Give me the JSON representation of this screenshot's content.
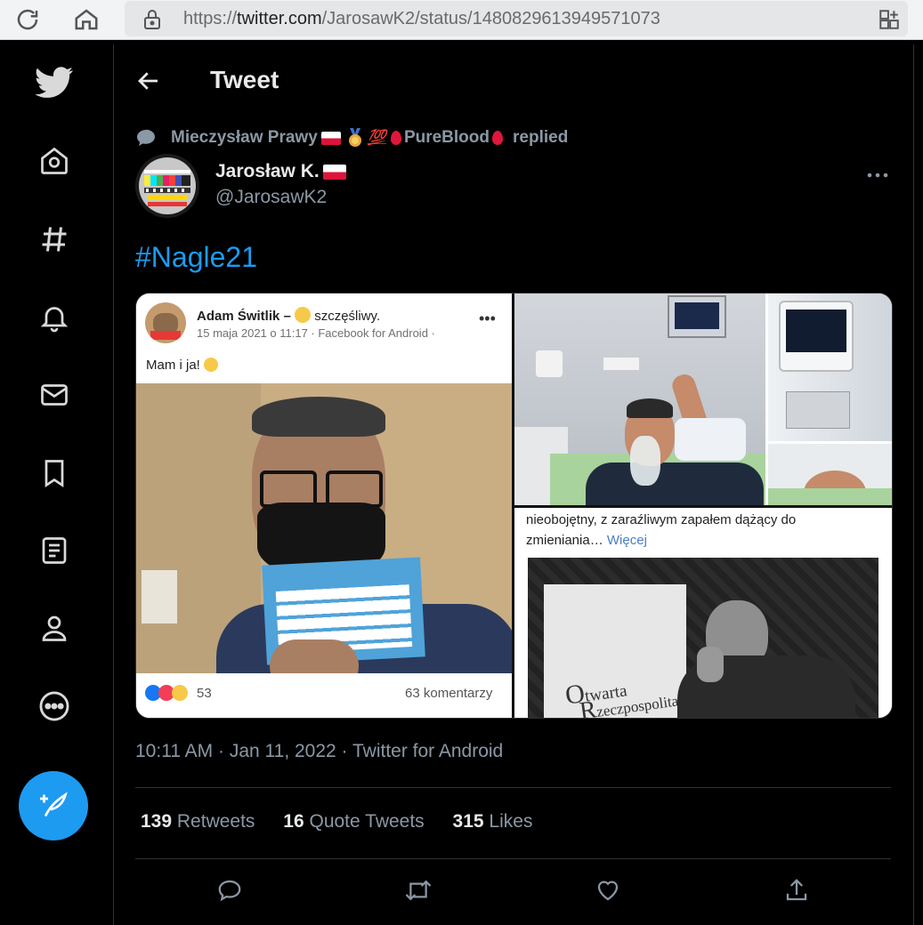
{
  "browser": {
    "url_prefix": "https://",
    "url_host": "twitter.com",
    "url_path": "/JarosawK2/status/1480829613949571073",
    "icons": [
      "reload-icon",
      "home-icon",
      "lock-icon",
      "collections-icon"
    ]
  },
  "sidebar": {
    "items": [
      {
        "icon": "twitter-logo-icon"
      },
      {
        "icon": "home-icon"
      },
      {
        "icon": "explore-hashtag-icon"
      },
      {
        "icon": "notifications-bell-icon"
      },
      {
        "icon": "messages-envelope-icon"
      },
      {
        "icon": "bookmark-icon"
      },
      {
        "icon": "lists-icon"
      },
      {
        "icon": "profile-icon"
      },
      {
        "icon": "more-circle-icon"
      }
    ],
    "compose_icon": "compose-feather-icon",
    "accent": "#1d9bf0"
  },
  "header": {
    "title": "Tweet"
  },
  "tweet": {
    "context": {
      "name": "Mieczysław Prawy",
      "badge_text": "PureBlood",
      "action": "replied"
    },
    "author": {
      "display_name": "Jarosław K.",
      "handle": "@JarosawK2"
    },
    "text": "#Nagle21",
    "media": {
      "post": {
        "author": "Adam Świtlik",
        "feeling": "szczęśliwy.",
        "meta": "15 maja 2021 o 11:17 · Facebook for Android ·",
        "text": "Mam i ja!",
        "reactions": "53",
        "comments": "63 komentarzy"
      },
      "right_text": "nieobojętny, z zaraźliwym zapałem dążący do",
      "right_text2": "zmieniania…",
      "right_more": "Więcej",
      "banner_text1": "twarta",
      "banner_text2": "zeczpospolita"
    },
    "timestamp": "10:11 AM · Jan 11, 2022 · Twitter for Android",
    "stats": {
      "retweets": "139",
      "retweets_label": "Retweets",
      "quotes": "16",
      "quotes_label": "Quote Tweets",
      "likes": "315",
      "likes_label": "Likes"
    },
    "actions": [
      "reply-icon",
      "retweet-icon",
      "like-icon",
      "share-icon"
    ]
  },
  "colors": {
    "background": "#000000",
    "muted": "#8b98a5",
    "text": "#e7e9ea",
    "link": "#1d9bf0"
  }
}
